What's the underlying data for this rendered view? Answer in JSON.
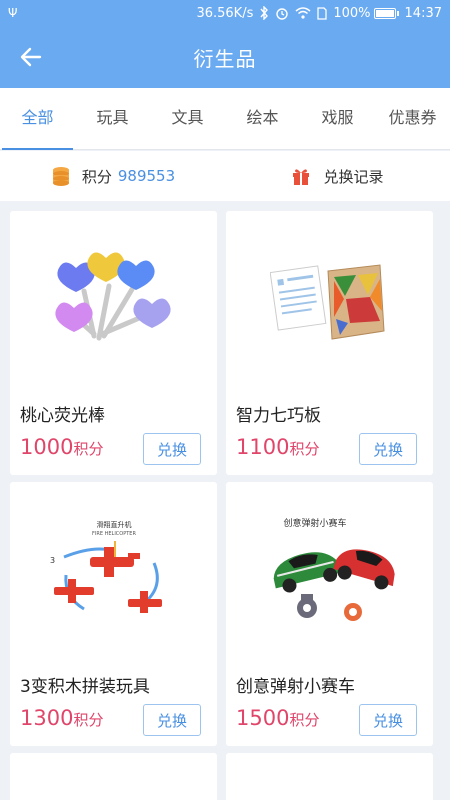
{
  "status_bar": {
    "usb": "Ψ",
    "speed": "36.56K/s",
    "battery_percent": "100%",
    "time": "14:37",
    "icons": [
      "usb-icon",
      "bluetooth-icon",
      "alarm-icon",
      "wifi-icon",
      "sim-icon",
      "battery-icon"
    ]
  },
  "app_bar": {
    "title": "衍生品",
    "back_icon": "arrow-left-icon"
  },
  "tabs": [
    {
      "label": "全部",
      "active": true
    },
    {
      "label": "玩具",
      "active": false
    },
    {
      "label": "文具",
      "active": false
    },
    {
      "label": "绘本",
      "active": false
    },
    {
      "label": "戏服",
      "active": false
    },
    {
      "label": "优惠券",
      "active": false
    }
  ],
  "points": {
    "label": "积分",
    "value": "989553",
    "records_label": "兑换记录",
    "icon": "coin-stack-icon",
    "records_icon": "gift-icon"
  },
  "products": [
    {
      "name": "桃心荧光棒",
      "price": "1000",
      "unit": "积分",
      "button": "兑换"
    },
    {
      "name": "智力七巧板",
      "price": "1100",
      "unit": "积分",
      "button": "兑换"
    },
    {
      "name": "3变积木拼装玩具",
      "price": "1300",
      "unit": "积分",
      "button": "兑换",
      "image_text": [
        "滑翔直升机",
        "FIRE HELICOPTER"
      ]
    },
    {
      "name": "创意弹射小赛车",
      "price": "1500",
      "unit": "积分",
      "button": "兑换",
      "image_text": [
        "创意弹射小赛车"
      ]
    }
  ],
  "colors": {
    "primary": "#6aaaf0",
    "accent": "#4a90e2",
    "price": "#e0456a",
    "background": "#eef2f6"
  }
}
